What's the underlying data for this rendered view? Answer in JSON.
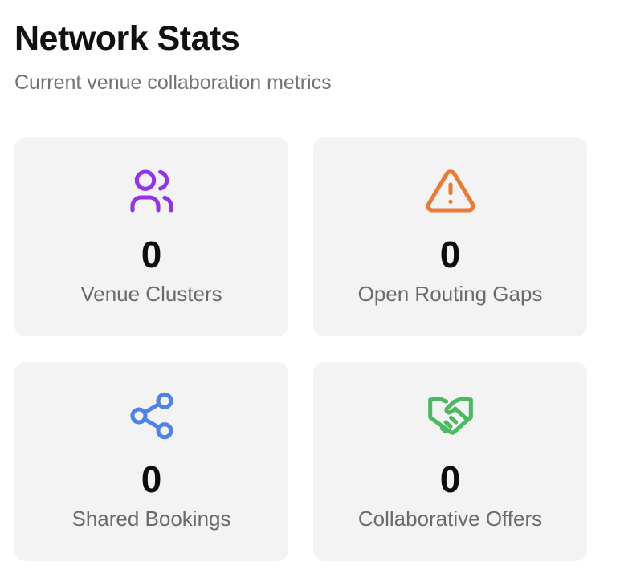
{
  "header": {
    "title": "Network Stats",
    "subtitle": "Current venue collaboration metrics"
  },
  "stats": [
    {
      "icon": "users-icon",
      "color": "#9333ea",
      "value": "0",
      "label": "Venue Clusters"
    },
    {
      "icon": "warning-triangle-icon",
      "color": "#ea7a35",
      "value": "0",
      "label": "Open Routing Gaps"
    },
    {
      "icon": "share-icon",
      "color": "#4f83e8",
      "value": "0",
      "label": "Shared Bookings"
    },
    {
      "icon": "handshake-icon",
      "color": "#4cb862",
      "value": "0",
      "label": "Collaborative Offers"
    }
  ],
  "colors": {
    "card_background": "#f3f3f3",
    "title_text": "#111111",
    "muted_text": "#737373"
  }
}
